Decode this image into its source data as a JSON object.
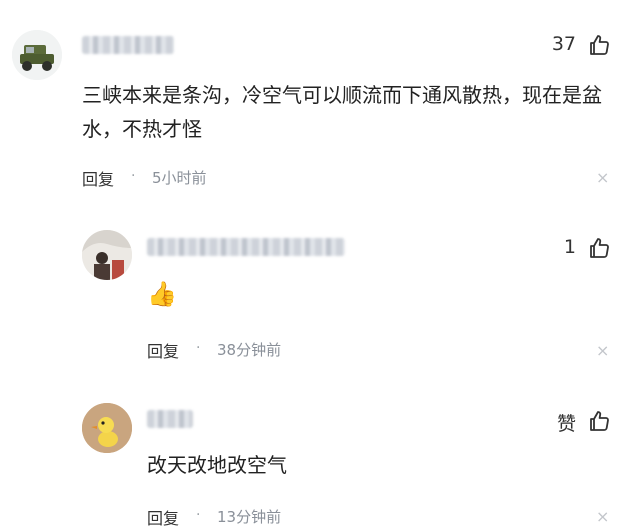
{
  "comments": [
    {
      "likes": "37",
      "text": "三峡本来是条沟，冷空气可以顺流而下通风散热，现在是盆水，不热才怪",
      "reply_label": "回复",
      "separator": "·",
      "time": "5小时前",
      "close_glyph": "×"
    },
    {
      "likes": "1",
      "emoji": "👍",
      "reply_label": "回复",
      "separator": "·",
      "time": "38分钟前",
      "close_glyph": "×"
    },
    {
      "likes": "赞",
      "text": "改天改地改空气",
      "reply_label": "回复",
      "separator": "·",
      "time": "13分钟前",
      "close_glyph": "×"
    }
  ]
}
